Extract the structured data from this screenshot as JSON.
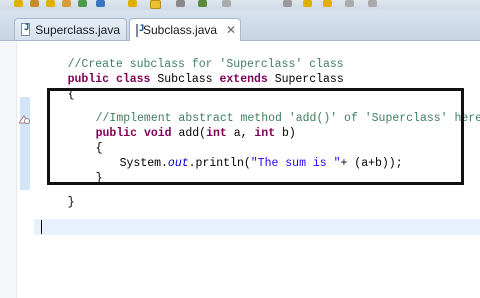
{
  "tabs": [
    {
      "label": "Superclass.java",
      "active": false
    },
    {
      "label": "Subclass.java",
      "active": true
    }
  ],
  "icons": {
    "tab_file": "java-file-icon",
    "close": "close-icon",
    "fold": "fold-collapse-icon"
  },
  "code": {
    "line1": "//Create subclass for 'Superclass' class",
    "line2_kw1": "public",
    "line2_kw2": "class",
    "line2_name": "Subclass",
    "line2_kw3": "extends",
    "line2_super": "Superclass",
    "line3": "{",
    "line4": "//Implement abstract method 'add()' of 'Superclass' here",
    "line5_kw1": "public",
    "line5_kw2": "void",
    "line5_a": "add(",
    "line5_kw3": "int",
    "line5_b": "a,",
    "line5_kw4": "int",
    "line5_c": "b)",
    "line6": "{",
    "line7_a": "System.",
    "line7_out": "out",
    "line7_b": ".println(",
    "line7_str": "\"The sum is \"",
    "line7_c": "+ (a+b));",
    "line8": "}",
    "line9": "}"
  },
  "colors": {
    "keyword": "#7f0055",
    "comment": "#3f7f5f",
    "string": "#2a00ff",
    "field": "#0000c0",
    "current_line": "#e8f2fe"
  }
}
